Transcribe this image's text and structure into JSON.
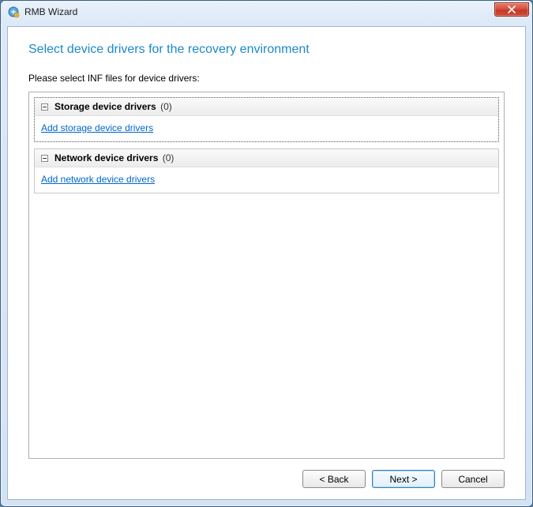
{
  "window": {
    "title": "RMB Wizard"
  },
  "page": {
    "heading": "Select device drivers for the recovery environment",
    "instruction": "Please select INF files for device drivers:"
  },
  "sections": {
    "storage": {
      "title": "Storage device drivers",
      "count": "(0)",
      "link": "Add storage device drivers"
    },
    "network": {
      "title": "Network device drivers",
      "count": "(0)",
      "link": "Add network device drivers"
    }
  },
  "buttons": {
    "back": "< Back",
    "next": "Next >",
    "cancel": "Cancel"
  }
}
